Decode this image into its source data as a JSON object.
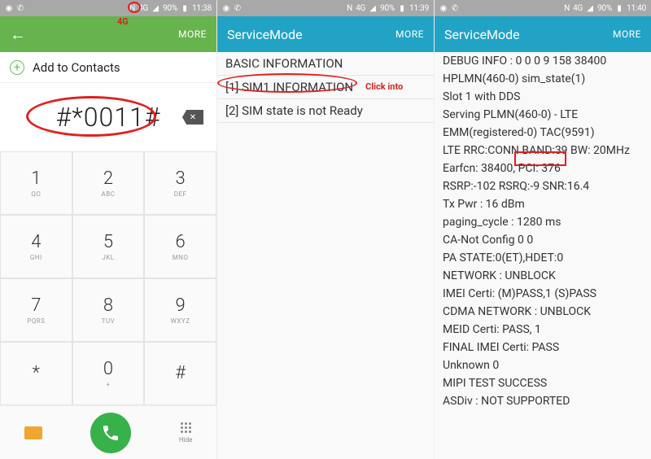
{
  "status": {
    "battery": "90%",
    "nfc": "N",
    "net": "4G",
    "times": [
      "11:38",
      "11:39",
      "11:40"
    ]
  },
  "pane1": {
    "more": "MORE",
    "add_contacts": "Add to Contacts",
    "dialed": "#*0011#",
    "keys": [
      {
        "n": "1",
        "s": "QO"
      },
      {
        "n": "2",
        "s": "ABC"
      },
      {
        "n": "3",
        "s": "DEF"
      },
      {
        "n": "4",
        "s": "GHI"
      },
      {
        "n": "5",
        "s": "JKL"
      },
      {
        "n": "6",
        "s": "MNO"
      },
      {
        "n": "7",
        "s": "PQRS"
      },
      {
        "n": "8",
        "s": "TUV"
      },
      {
        "n": "9",
        "s": "WXYZ"
      },
      {
        "n": "*",
        "s": ""
      },
      {
        "n": "0",
        "s": "+"
      },
      {
        "n": "#",
        "s": ""
      }
    ],
    "hide": "Hide"
  },
  "pane2": {
    "title": "ServiceMode",
    "more": "MORE",
    "items": [
      "BASIC INFORMATION",
      "[1] SIM1 INFORMATION",
      "[2] SIM state is not Ready"
    ]
  },
  "pane3": {
    "title": "ServiceMode",
    "more": "MORE",
    "items": [
      "DEBUG INFO : 0 0 0 9 158 38400",
      "HPLMN(460-0) sim_state(1)",
      "Slot 1 with DDS",
      "Serving PLMN(460-0) - LTE",
      "EMM(registered-0) TAC(9591)",
      "LTE RRC:CONN BAND:39 BW: 20MHz",
      "Earfcn: 38400, PCI: 376",
      "RSRP:-102 RSRQ:-9 SNR:16.4",
      "Tx Pwr : 16 dBm",
      "paging_cycle : 1280 ms",
      "CA-Not Config 0 0",
      "PA STATE:0(ET),HDET:0",
      "NETWORK : UNBLOCK",
      "IMEI Certi: (M)PASS,1 (S)PASS",
      "CDMA NETWORK : UNBLOCK",
      "MEID Certi: PASS, 1",
      "FINAL IMEI Certi: PASS",
      "Unknown 0",
      "MIPI TEST SUCCESS",
      "ASDiv : NOT SUPPORTED"
    ]
  },
  "anno": {
    "fourG": "4G",
    "click": "Click into"
  }
}
